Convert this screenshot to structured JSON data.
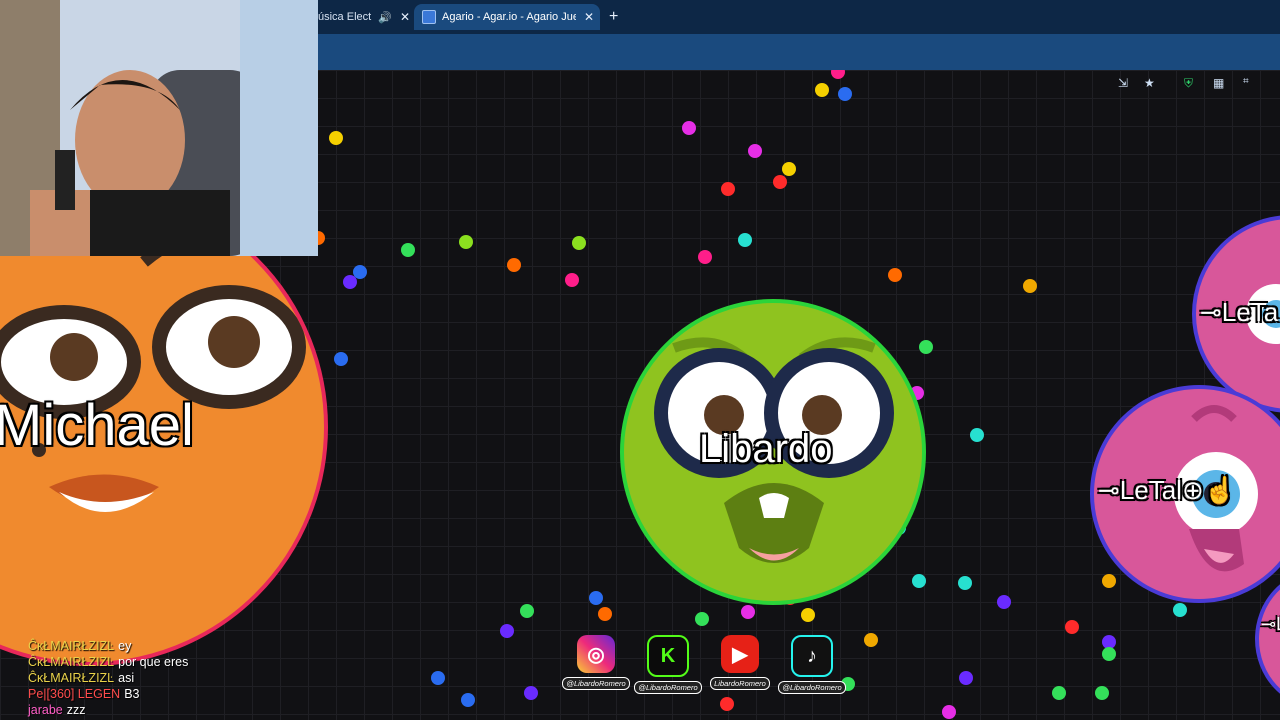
{
  "browser": {
    "tabs": [
      {
        "title": "úsica Electr",
        "active": false
      },
      {
        "title": "Agario - Agar.io - Agario Juego",
        "active": true
      }
    ],
    "new_tab_label": "+"
  },
  "cells": {
    "player": {
      "name": "Libardo",
      "color": "#8fc31f",
      "border": "#2bd43a"
    },
    "enemy_left": {
      "name": "Michael",
      "color": "#f08a2e",
      "border": "#e8285a"
    },
    "enemy_right": {
      "name": "⊸LeTal⊕☝",
      "name_top": "⊸LeTa",
      "name_bottom": "⊸L",
      "color": "#d8579a",
      "border": "#4a3bd6"
    }
  },
  "chat": [
    {
      "user": "ĈĸŁMAIRŁZIZĿ",
      "message": "ey",
      "color": "yellow"
    },
    {
      "user": "ĈĸŁMAIRŁZIZĿ",
      "message": "por que eres",
      "color": "yellow"
    },
    {
      "user": "ĈĸŁMAIRŁZIZĿ",
      "message": "asi",
      "color": "yellow"
    },
    {
      "user": "Pe|[360] LEGEN",
      "message": "B3",
      "color": "red"
    },
    {
      "user": "jarabe",
      "message": "zzz",
      "color": "pink"
    }
  ],
  "socials": [
    {
      "name": "instagram",
      "glyph": "◎",
      "handle": "@LibardoRomero",
      "color": "#d62976"
    },
    {
      "name": "kick",
      "glyph": "K",
      "handle": "@LibardoRomero",
      "color": "#53fc18"
    },
    {
      "name": "youtube",
      "glyph": "▶",
      "handle": "LibardoRomero",
      "color": "#e62117"
    },
    {
      "name": "tiktok",
      "glyph": "♪",
      "handle": "@LibardoRomero",
      "color": "#111111"
    }
  ],
  "colors": {
    "pellet_palette": [
      "#f5d000",
      "#34e05a",
      "#8be01f",
      "#ff1e8a",
      "#e62ee6",
      "#2a6cf0",
      "#27e0d0",
      "#ff6a00",
      "#ff2b2b",
      "#f0a800",
      "#6a2bff"
    ]
  }
}
